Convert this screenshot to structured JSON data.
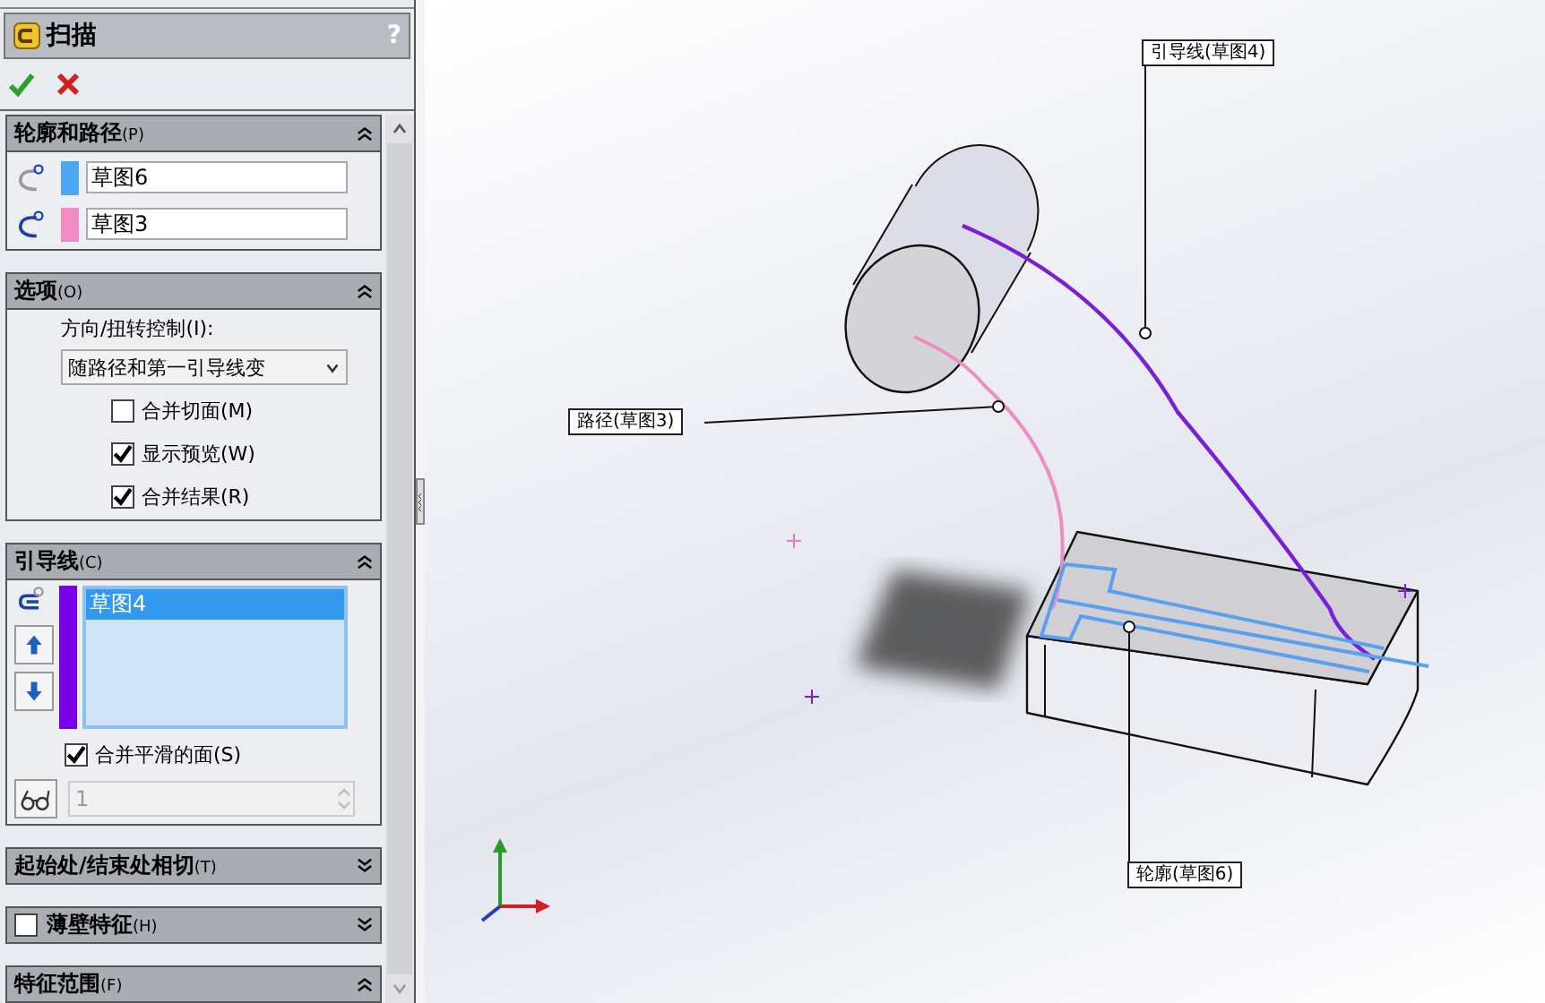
{
  "panel": {
    "title": "扫描",
    "help": "?",
    "sections": [
      {
        "kind": "profile_path",
        "title": "轮廓和路径",
        "shortcut": "(P)",
        "expanded": true,
        "fields": [
          {
            "value": "草图6",
            "color": "#4da6f2"
          },
          {
            "value": "草图3",
            "color": "#f28cc4"
          }
        ]
      },
      {
        "kind": "options",
        "title": "选项",
        "shortcut": "(O)",
        "expanded": true,
        "label": "方向/扭转控制(I):",
        "dropdown": "随路径和第一引导线变",
        "checks": [
          {
            "label": "合并切面(M)",
            "checked": false
          },
          {
            "label": "显示预览(W)",
            "checked": true
          },
          {
            "label": "合并结果(R)",
            "checked": true
          }
        ]
      },
      {
        "kind": "guides",
        "title": "引导线",
        "shortcut": "(C)",
        "expanded": true,
        "color": "#7a00e6",
        "items": [
          {
            "label": "草图4",
            "selected": true
          }
        ],
        "checks": [
          {
            "label": "合并平滑的面(S)",
            "checked": true
          }
        ],
        "spinner": {
          "value": "1",
          "disabled": true
        }
      },
      {
        "kind": "plain",
        "title": "起始处/结束处相切",
        "shortcut": "(T)",
        "expanded": false
      },
      {
        "kind": "checkable",
        "title": "薄壁特征",
        "shortcut": "(H)",
        "expanded": false,
        "checked": false
      },
      {
        "kind": "plain",
        "title": "特征范围",
        "shortcut": "(F)",
        "expanded": true
      }
    ]
  },
  "viewport": {
    "callouts": [
      {
        "label": "引导线(草图4)"
      },
      {
        "label": "路径(草图3)"
      },
      {
        "label": "轮廓(草图6)"
      }
    ]
  }
}
